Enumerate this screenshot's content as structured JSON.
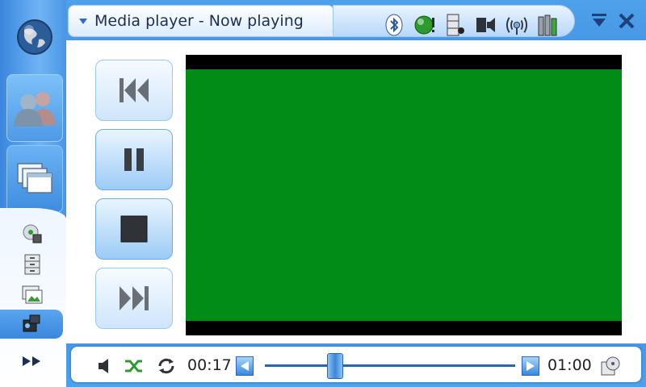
{
  "window": {
    "title": "Media player - Now playing"
  },
  "navigator": {
    "buttons": [
      {
        "icon": "globe-icon"
      },
      {
        "icon": "contacts-icon"
      },
      {
        "icon": "applications-icon"
      }
    ],
    "small_items": [
      {
        "icon": "cd-icon"
      },
      {
        "icon": "filing-cabinet-icon"
      },
      {
        "icon": "image-viewer-icon"
      },
      {
        "icon": "media-player-icon"
      }
    ],
    "more_icon": "double-arrow-icon"
  },
  "status_icons": [
    "bluetooth-icon",
    "presence-icon",
    "memory-card-icon",
    "volume-icon",
    "connectivity-icon",
    "battery-icon"
  ],
  "controls": {
    "buttons": [
      "previous-icon",
      "pause-icon",
      "stop-icon",
      "next-icon"
    ]
  },
  "playback": {
    "elapsed": "00:17",
    "duration": "01:00",
    "position_fraction": 0.28
  },
  "colors": {
    "accent": "#3f8fdf",
    "video": "#008c17",
    "title_text": "#1d2e52"
  }
}
